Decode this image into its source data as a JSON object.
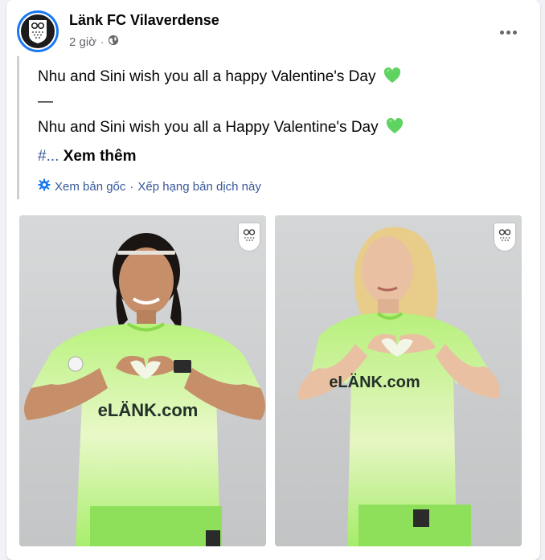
{
  "post": {
    "page_name": "Länk FC Vilaverdense",
    "time": "2 giờ",
    "separator": "·",
    "line1": "Nhu and Sini wish you all a happy Valentine's Day",
    "divider": "—",
    "line2": "Nhu and Sini wish you all a Happy Valentine's Day",
    "hash_prefix": "#...",
    "see_more": "Xem thêm"
  },
  "translation": {
    "view_original": "Xem bản gốc",
    "separator": "·",
    "rate": "Xếp hạng bản dịch này"
  },
  "photos": [
    {
      "jersey_text": "eLÄNK.com"
    },
    {
      "jersey_text": "eLÄNK.com"
    }
  ],
  "icons": {
    "more": "more-options-icon",
    "globe": "globe-icon",
    "heart": "green-heart-icon",
    "gear": "gear-icon",
    "badge": "club-crest-icon"
  },
  "colors": {
    "link": "#385898",
    "heart": "#5fd35f",
    "jersey": "#a8f06e",
    "avatar_ring": "#1877f2"
  }
}
